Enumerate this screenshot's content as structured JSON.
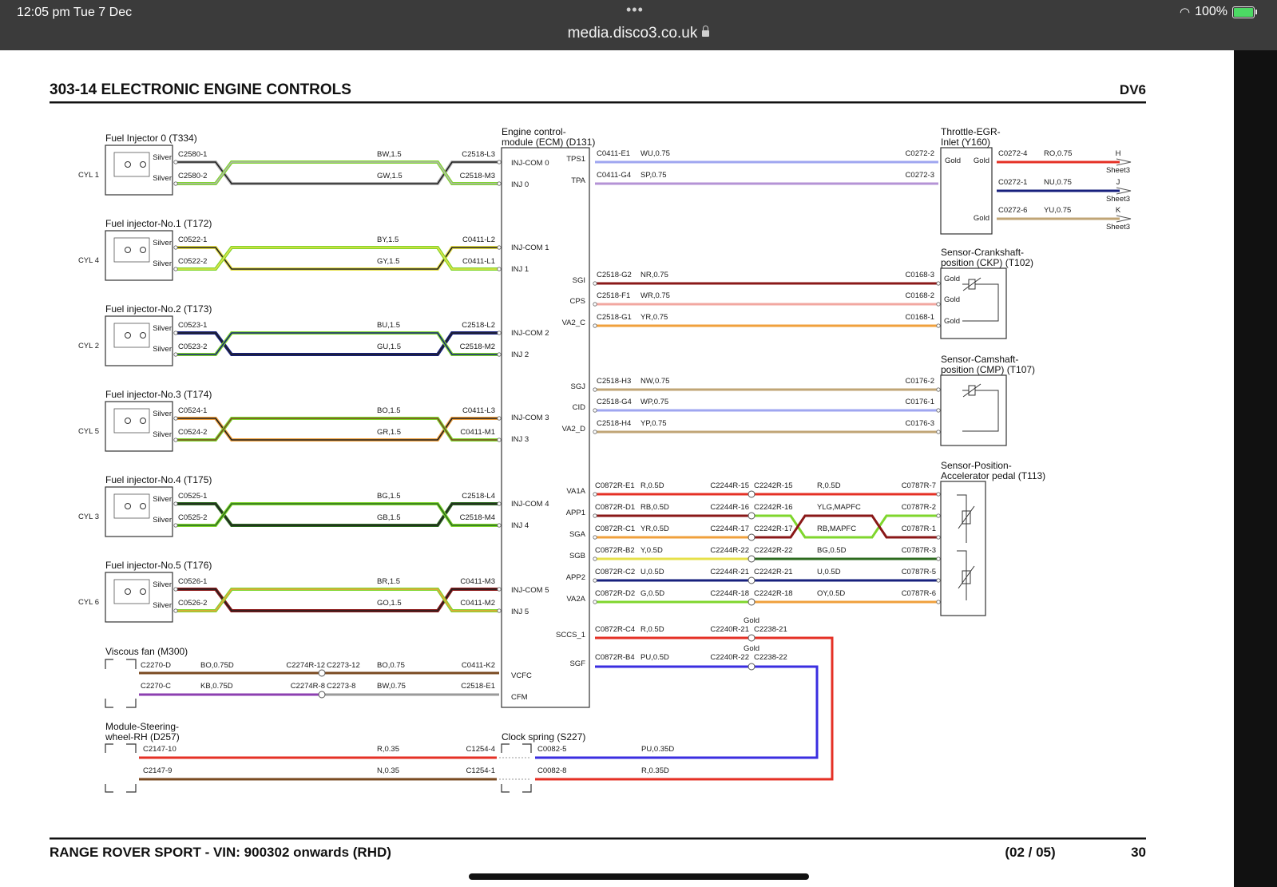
{
  "status": {
    "time": "12:05 pm   Tue 7 Dec",
    "url": "media.disco3.co.uk",
    "battery": "100%",
    "more": "•••"
  },
  "header": {
    "title": "303-14 ELECTRONIC ENGINE CONTROLS",
    "code": "DV6"
  },
  "footer": {
    "vehicle": "RANGE ROVER SPORT - VIN: 900302 onwards  (RHD)",
    "sheet": "(02 / 05)",
    "page": "30"
  },
  "colors": {
    "bg": "#ffffff",
    "statusbar": "#3b3b3b",
    "wire_black": "#202020",
    "wire_white": "#b4b4b4",
    "wire_green": "#7fd62d",
    "wire_blue": "#17207d",
    "wire_brown": "#7a4a21",
    "wire_red": "#e53025",
    "wire_orange": "#f0a03c",
    "wire_yellow": "#e6e04a",
    "wire_purple": "#8c3fb0",
    "wire_pink": "#f2a7a0",
    "wire_grey": "#9a9a9a",
    "wire_lightblue": "#9fa6f0",
    "wire_violet": "#3a2ee0",
    "wire_darkgreen": "#2c6a1e",
    "wire_darkred": "#8a1818",
    "wire_tan": "#c0a576"
  },
  "ecm": {
    "title_line1": "Engine control-",
    "title_line2": "module (ECM) (D131)",
    "left_pins": [
      "INJ-COM 0",
      "INJ 0",
      "INJ-COM 1",
      "INJ 1",
      "INJ-COM 2",
      "INJ 2",
      "INJ-COM 3",
      "INJ 3",
      "INJ-COM 4",
      "INJ 4",
      "INJ-COM 5",
      "INJ 5",
      "VCFC",
      "CFM"
    ],
    "right_pins": [
      "TPS1",
      "TPA",
      "SGI",
      "CPS",
      "VA2_C",
      "SGJ",
      "CID",
      "VA2_D",
      "VA1A",
      "APP1",
      "SGA",
      "SGB",
      "APP2",
      "VA2A",
      "SCCS_1",
      "SGF"
    ]
  },
  "injectors": [
    {
      "title": "Fuel Injector 0 (T334)",
      "cyl": "CYL 1",
      "pin1": "Silver",
      "pin2": "Silver",
      "c1": "C2580-1",
      "c2": "C2580-2",
      "w1": "BW,1.5",
      "w2": "GW,1.5",
      "e1": "C2518-L3",
      "e2": "C2518-M3"
    },
    {
      "title": "Fuel injector-No.1 (T172)",
      "cyl": "CYL 4",
      "pin1": "Silver",
      "pin2": "Silver",
      "c1": "C0522-1",
      "c2": "C0522-2",
      "w1": "BY,1.5",
      "w2": "GY,1.5",
      "e1": "C0411-L2",
      "e2": "C0411-L1"
    },
    {
      "title": "Fuel injector-No.2 (T173)",
      "cyl": "CYL 2",
      "pin1": "Silver",
      "pin2": "Silver",
      "c1": "C0523-1",
      "c2": "C0523-2",
      "w1": "BU,1.5",
      "w2": "GU,1.5",
      "e1": "C2518-L2",
      "e2": "C2518-M2"
    },
    {
      "title": "Fuel injector-No.3 (T174)",
      "cyl": "CYL 5",
      "pin1": "Silver",
      "pin2": "Silver",
      "c1": "C0524-1",
      "c2": "C0524-2",
      "w1": "BO,1.5",
      "w2": "GR,1.5",
      "e1": "C0411-L3",
      "e2": "C0411-M1"
    },
    {
      "title": "Fuel injector-No.4 (T175)",
      "cyl": "CYL 3",
      "pin1": "Silver",
      "pin2": "Silver",
      "c1": "C0525-1",
      "c2": "C0525-2",
      "w1": "BG,1.5",
      "w2": "GB,1.5",
      "e1": "C2518-L4",
      "e2": "C2518-M4"
    },
    {
      "title": "Fuel injector-No.5 (T176)",
      "cyl": "CYL 6",
      "pin1": "Silver",
      "pin2": "Silver",
      "c1": "C0526-1",
      "c2": "C0526-2",
      "w1": "BR,1.5",
      "w2": "GO,1.5",
      "e1": "C0411-M3",
      "e2": "C0411-M2"
    }
  ],
  "viscous_fan": {
    "title": "Viscous fan (M300)",
    "w1": {
      "c1": "C2270-D",
      "spec1": "BO,0.75D",
      "s1": "C2274R-12",
      "s2": "C2273-12",
      "spec2": "BO,0.75",
      "e": "C0411-K2"
    },
    "w2": {
      "c1": "C2270-C",
      "spec1": "KB,0.75D",
      "s1": "C2274R-8",
      "s2": "C2273-8",
      "spec2": "BW,0.75",
      "e": "C2518-E1"
    }
  },
  "steering": {
    "title_line1": "Module-Steering-",
    "title_line2": "wheel-RH (D257)",
    "w1": {
      "c": "C2147-10",
      "spec": "R,0.35",
      "e": "C1254-4"
    },
    "w2": {
      "c": "C2147-9",
      "spec": "N,0.35",
      "e": "C1254-1"
    }
  },
  "clock_spring": {
    "title": "Clock spring (S227)",
    "w1": {
      "c": "C0082-5",
      "spec": "PU,0.35D"
    },
    "w2": {
      "c": "C0082-8",
      "spec": "R,0.35D"
    }
  },
  "throttle": {
    "title_line1": "Throttle-EGR-",
    "title_line2": "Inlet (Y160)",
    "inner_left": "Gold",
    "inner_right": "Gold",
    "inner_bottom": "Gold",
    "w1": {
      "c": "C0411-E1",
      "spec": "WU,0.75",
      "e": "C0272-2"
    },
    "w2": {
      "c": "C0411-G4",
      "spec": "SP,0.75",
      "e": "C0272-3"
    },
    "out": [
      {
        "c": "C0272-4",
        "spec": "RO,0.75",
        "letter": "H",
        "sheet": "Sheet3"
      },
      {
        "c": "C0272-1",
        "spec": "NU,0.75",
        "letter": "J",
        "sheet": "Sheet3"
      },
      {
        "c": "C0272-6",
        "spec": "YU,0.75",
        "letter": "K",
        "sheet": "Sheet3"
      }
    ]
  },
  "ckp": {
    "title_line1": "Sensor-Crankshaft-",
    "title_line2": "position (CKP) (T102)",
    "pins": [
      "Gold",
      "Gold",
      "Gold"
    ],
    "wires": [
      {
        "c": "C2518-G2",
        "spec": "NR,0.75",
        "e": "C0168-3"
      },
      {
        "c": "C2518-F1",
        "spec": "WR,0.75",
        "e": "C0168-2"
      },
      {
        "c": "C2518-G1",
        "spec": "YR,0.75",
        "e": "C0168-1"
      }
    ]
  },
  "cmp": {
    "title_line1": "Sensor-Camshaft-",
    "title_line2": "position (CMP) (T107)",
    "wires": [
      {
        "c": "C2518-H3",
        "spec": "NW,0.75",
        "e": "C0176-2"
      },
      {
        "c": "C2518-G4",
        "spec": "WP,0.75",
        "e": "C0176-1"
      },
      {
        "c": "C2518-H4",
        "spec": "YP,0.75",
        "e": "C0176-3"
      }
    ]
  },
  "app": {
    "title_line1": "Sensor-Position-",
    "title_line2": "Accelerator pedal (T113)",
    "wires": [
      {
        "c": "C0872R-E1",
        "spec1": "R,0.5D",
        "s1": "C2244R-15",
        "s2": "C2242R-15",
        "spec2": "R,0.5D",
        "e": "C0787R-7"
      },
      {
        "c": "C0872R-D1",
        "spec1": "RB,0.5D",
        "s1": "C2244R-16",
        "s2": "C2242R-16",
        "spec2": "YLG,MAPFC",
        "e": "C0787R-2"
      },
      {
        "c": "C0872R-C1",
        "spec1": "YR,0.5D",
        "s1": "C2244R-17",
        "s2": "C2242R-17",
        "spec2": "RB,MAPFC",
        "e": "C0787R-1"
      },
      {
        "c": "C0872R-B2",
        "spec1": "Y,0.5D",
        "s1": "C2244R-22",
        "s2": "C2242R-22",
        "spec2": "BG,0.5D",
        "e": "C0787R-3"
      },
      {
        "c": "C0872R-C2",
        "spec1": "U,0.5D",
        "s1": "C2244R-21",
        "s2": "C2242R-21",
        "spec2": "U,0.5D",
        "e": "C0787R-5"
      },
      {
        "c": "C0872R-D2",
        "spec1": "G,0.5D",
        "s1": "C2244R-18",
        "s2": "C2242R-18",
        "spec2": "OY,0.5D",
        "e": "C0787R-6"
      }
    ]
  },
  "sccs": {
    "w1": {
      "c": "C0872R-C4",
      "spec": "R,0.5D",
      "gold": "Gold",
      "s1": "C2240R-21",
      "s2": "C2238-21"
    },
    "w2": {
      "c": "C0872R-B4",
      "spec": "PU,0.5D",
      "gold": "Gold",
      "s1": "C2240R-22",
      "s2": "C2238-22"
    }
  }
}
